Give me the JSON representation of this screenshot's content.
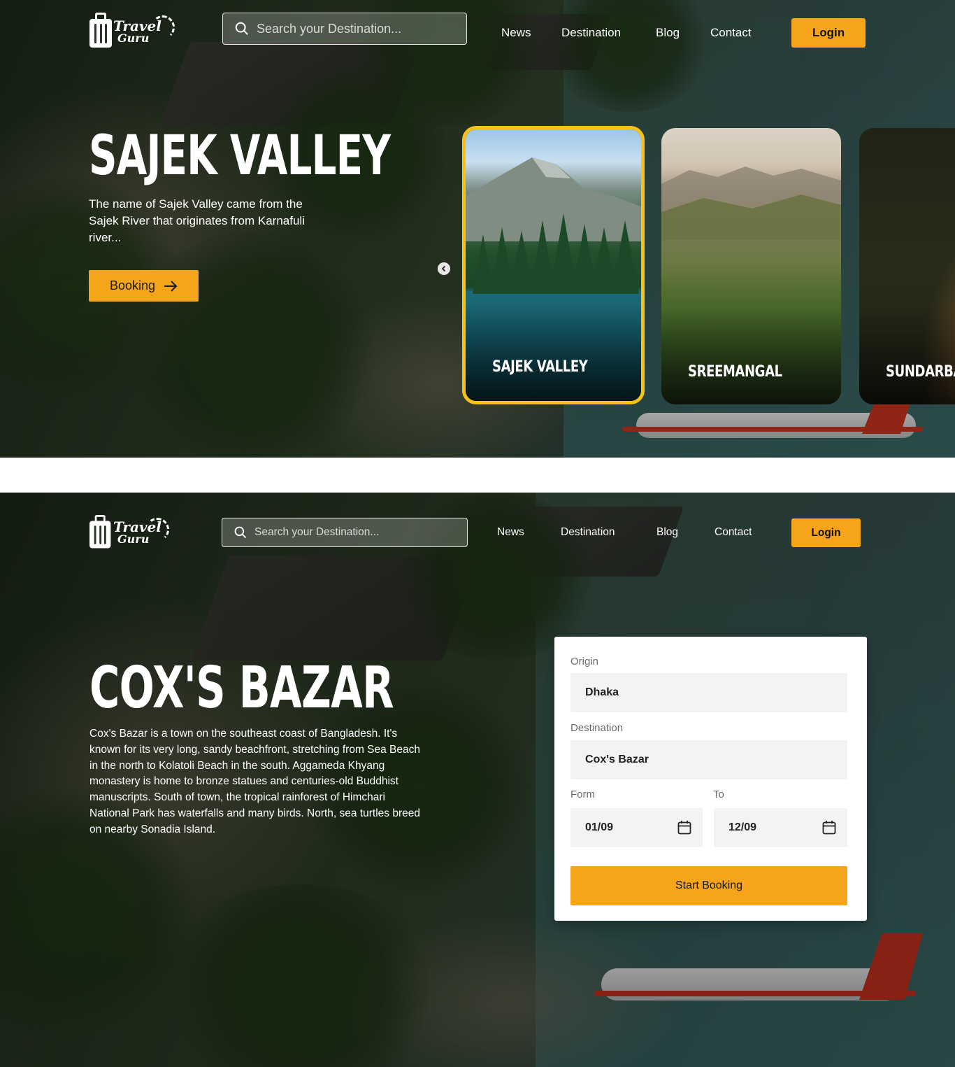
{
  "brand": {
    "line1": "Travel",
    "line2": "Guru"
  },
  "nav": {
    "search_placeholder": "Search your Destination...",
    "links": [
      "News",
      "Destination",
      "Blog",
      "Contact"
    ],
    "login_label": "Login"
  },
  "slider_section": {
    "title": "SAJEK VALLEY",
    "description": "The name of Sajek Valley came from the Sajek River that originates from Karnafuli river...",
    "booking_label": "Booking",
    "cards": [
      {
        "label": "SAJEK VALLEY",
        "active": true
      },
      {
        "label": "SREEMANGAL",
        "active": false
      },
      {
        "label": "SUNDARBAN",
        "active": false
      }
    ]
  },
  "booking_section": {
    "title": "COX'S BAZAR",
    "description": "Cox's Bazar is a town on the southeast coast of Bangladesh. It's known for its very long, sandy beachfront, stretching from Sea Beach in the north to Kolatoli Beach in the south. Aggameda Khyang monastery is home to bronze statues and centuries-old Buddhist manuscripts. South of town, the tropical rainforest of Himchari National Park has waterfalls and many birds. North, sea turtles breed on nearby Sonadia Island.",
    "form": {
      "origin_label": "Origin",
      "origin_value": "Dhaka",
      "destination_label": "Destination",
      "destination_value": "Cox's Bazar",
      "from_label": "Form",
      "from_value": "01/09",
      "to_label": "To",
      "to_value": "12/09",
      "submit_label": "Start Booking"
    }
  },
  "colors": {
    "accent": "#f6a51a",
    "active_border": "#f6c21a"
  }
}
